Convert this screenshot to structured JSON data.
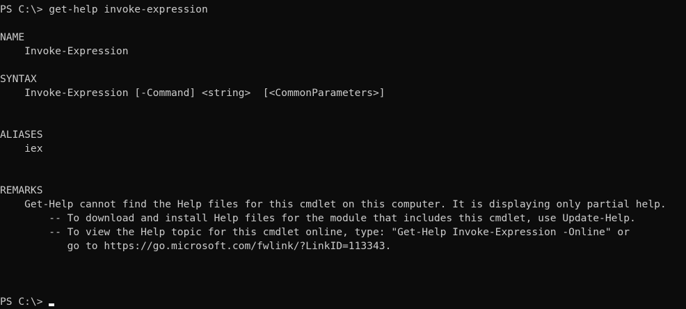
{
  "terminal": {
    "lines": [
      "PS C:\\> get-help invoke-expression",
      "",
      "NAME",
      "    Invoke-Expression",
      "",
      "SYNTAX",
      "    Invoke-Expression [-Command] <string>  [<CommonParameters>]",
      "",
      "",
      "ALIASES",
      "    iex",
      "",
      "",
      "REMARKS",
      "    Get-Help cannot find the Help files for this cmdlet on this computer. It is displaying only partial help.",
      "        -- To download and install Help files for the module that includes this cmdlet, use Update-Help.",
      "        -- To view the Help topic for this cmdlet online, type: \"Get-Help Invoke-Expression -Online\" or",
      "           go to https://go.microsoft.com/fwlink/?LinkID=113343.",
      "",
      "",
      "",
      "PS C:\\> "
    ]
  }
}
